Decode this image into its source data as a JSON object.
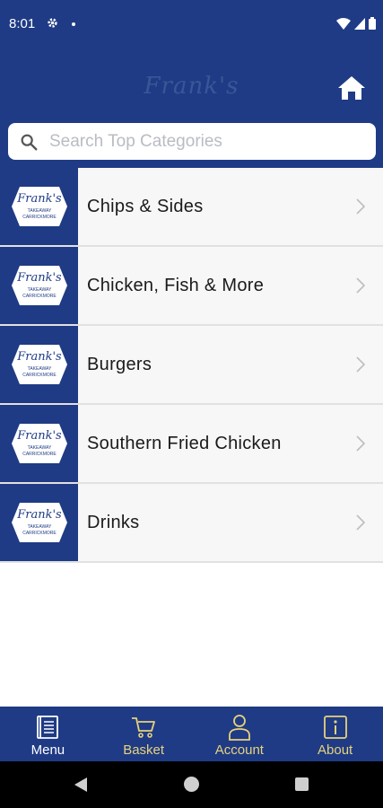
{
  "status_bar": {
    "time": "8:01"
  },
  "header": {
    "brand_name": "Frank's"
  },
  "search": {
    "placeholder": "Search Top Categories",
    "value": ""
  },
  "logo_text": {
    "line1": "Frank's",
    "line2": "TAKEAWAY",
    "line3": "CARRICKMORE"
  },
  "categories": [
    {
      "label": "Chips & Sides"
    },
    {
      "label": "Chicken, Fish & More"
    },
    {
      "label": "Burgers"
    },
    {
      "label": "Southern Fried Chicken"
    },
    {
      "label": "Drinks"
    }
  ],
  "bottom_nav": {
    "items": [
      {
        "label": "Menu",
        "icon": "menu-book-icon",
        "color": "#ffffff"
      },
      {
        "label": "Basket",
        "icon": "cart-icon",
        "color": "#e7d27c"
      },
      {
        "label": "Account",
        "icon": "person-icon",
        "color": "#e7d27c"
      },
      {
        "label": "About",
        "icon": "info-icon",
        "color": "#e7d27c"
      }
    ]
  },
  "colors": {
    "brand_blue": "#1f3b85",
    "accent_gold": "#e7d27c",
    "row_bg": "#f7f7f7"
  }
}
